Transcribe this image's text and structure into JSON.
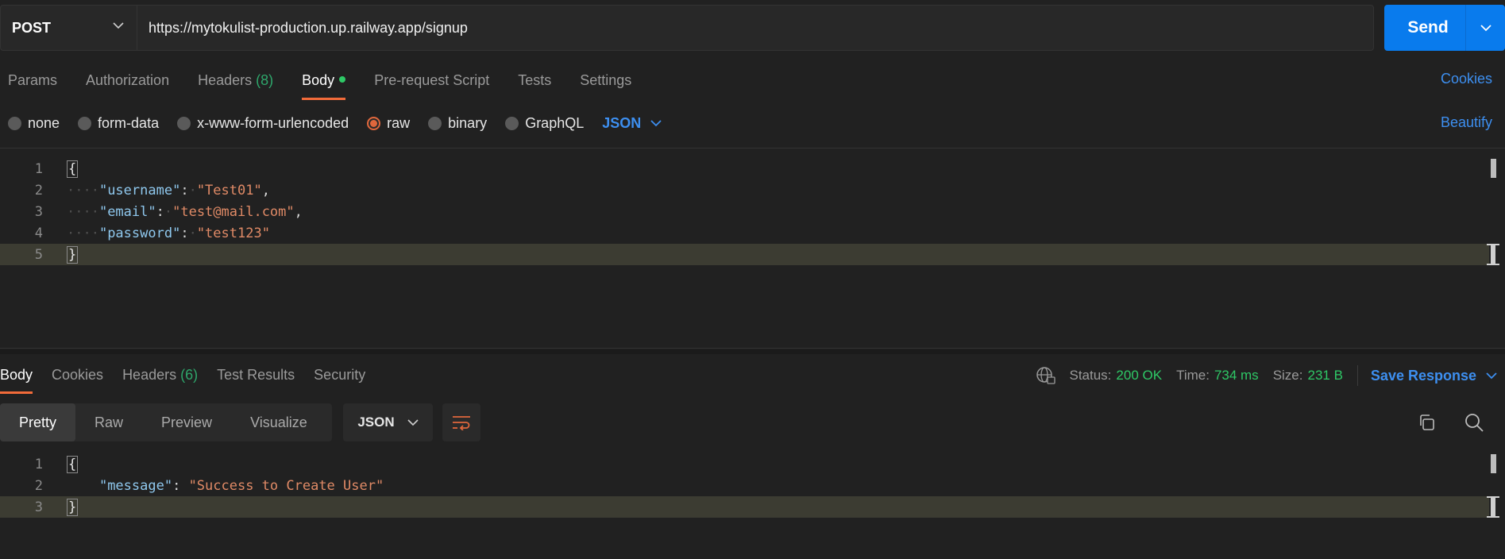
{
  "request": {
    "method": "POST",
    "url": "https://mytokulist-production.up.railway.app/signup",
    "send_label": "Send"
  },
  "request_tabs": [
    {
      "label": "Params"
    },
    {
      "label": "Authorization"
    },
    {
      "label": "Headers",
      "count": "(8)"
    },
    {
      "label": "Body"
    },
    {
      "label": "Pre-request Script"
    },
    {
      "label": "Tests"
    },
    {
      "label": "Settings"
    }
  ],
  "cookies_label": "Cookies",
  "body_types": [
    "none",
    "form-data",
    "x-www-form-urlencoded",
    "raw",
    "binary",
    "GraphQL"
  ],
  "body_selected": "raw",
  "body_format": "JSON",
  "beautify_label": "Beautify",
  "request_body": {
    "line_numbers": [
      "1",
      "2",
      "3",
      "4",
      "5"
    ],
    "open": "{",
    "close": "}",
    "fields": [
      {
        "key": "\"username\"",
        "value": "\"Test01\"",
        "sep": ","
      },
      {
        "key": "\"email\"",
        "value": "\"test@mail.com\"",
        "sep": ","
      },
      {
        "key": "\"password\"",
        "value": "\"test123\"",
        "sep": ""
      }
    ]
  },
  "response_tabs": [
    {
      "label": "Body"
    },
    {
      "label": "Cookies"
    },
    {
      "label": "Headers",
      "count": "(6)"
    },
    {
      "label": "Test Results"
    },
    {
      "label": "Security"
    }
  ],
  "response_status": {
    "status_label": "Status:",
    "status_value": "200 OK",
    "time_label": "Time:",
    "time_value": "734 ms",
    "size_label": "Size:",
    "size_value": "231 B",
    "save_label": "Save Response"
  },
  "response_views": [
    "Pretty",
    "Raw",
    "Preview",
    "Visualize"
  ],
  "response_format": "JSON",
  "response_body": {
    "line_numbers": [
      "1",
      "2",
      "3"
    ],
    "open": "{",
    "close": "}",
    "key": "\"message\"",
    "value": "\"Success to Create User\""
  },
  "colors": {
    "accent_orange": "#f26b3a",
    "link_blue": "#3d8ff0",
    "send_blue": "#097bed",
    "status_green": "#2ec866"
  }
}
